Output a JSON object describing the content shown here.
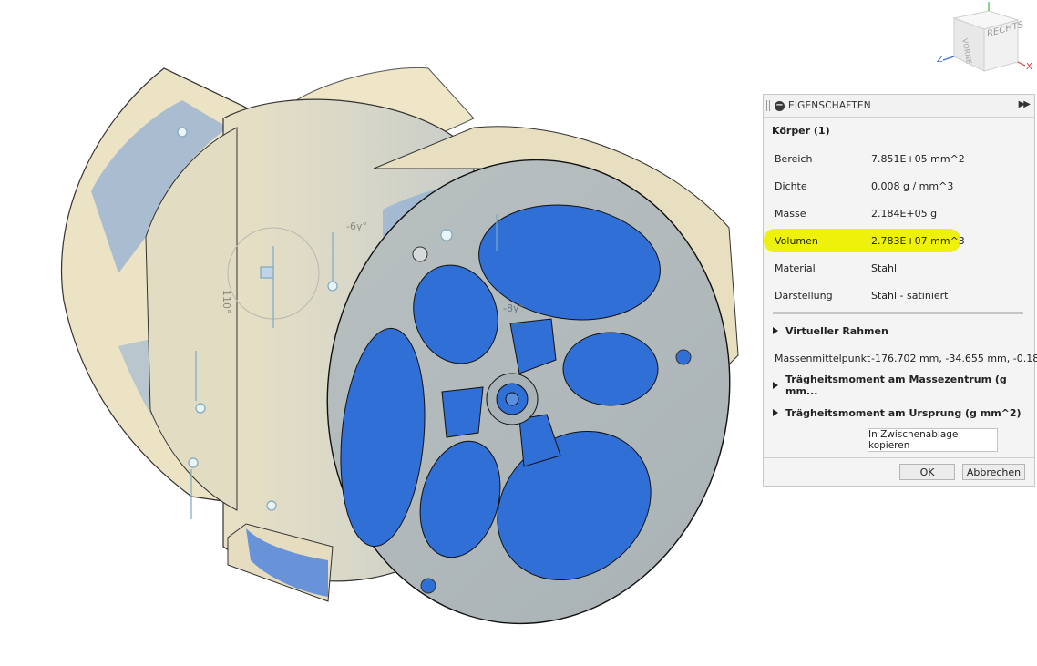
{
  "viewcube": {
    "face_front": "VORNE",
    "face_right": "RECHTS",
    "axis_x": "X",
    "axis_z": "Z"
  },
  "panel": {
    "title": "EIGENSCHAFTEN",
    "body_title": "Körper (1)",
    "properties": [
      {
        "key": "Bereich",
        "value": "7.851E+05 mm^2"
      },
      {
        "key": "Dichte",
        "value": "0.008 g / mm^3"
      },
      {
        "key": "Masse",
        "value": "2.184E+05 g"
      },
      {
        "key": "Volumen",
        "value": "2.783E+07 mm^3",
        "highlighted": true
      },
      {
        "key": "Material",
        "value": "Stahl"
      },
      {
        "key": "Darstellung",
        "value": "Stahl - satiniert"
      }
    ],
    "section_virtual_frame": "Virtueller Rahmen",
    "center_of_mass_key": "Massenmittelpunkt",
    "center_of_mass_value": "-176.702 mm, -34.655 mm, -0.18...",
    "section_inertia_center": "Trägheitsmoment am Massezentrum   (g mm...",
    "section_inertia_origin": "Trägheitsmoment am Ursprung   (g mm^2)",
    "copy_button": "In Zwischenablage kopieren",
    "ok_button": "OK",
    "cancel_button": "Abbrechen"
  },
  "model_labels": {
    "dim_left": "110°",
    "dim_top": "-6y°",
    "dim_mid": "-8y°"
  },
  "colors": {
    "highlight": "#eef20a",
    "hole_blue": "#2f6fd6",
    "body_beige": "#e9e2c6",
    "body_grey": "#c9cbc6"
  }
}
